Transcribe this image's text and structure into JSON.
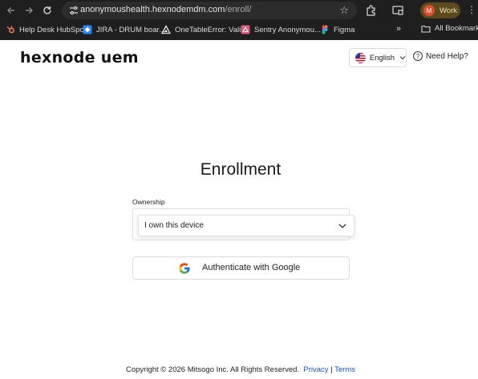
{
  "browser": {
    "url_host": "anonymoushealth.hexnodemdm.com",
    "url_path": "/enroll/",
    "profile_initial": "M",
    "profile_label": "Work",
    "bookmarks": [
      {
        "label": "Help Desk HubSpot",
        "icon": "hubspot-icon",
        "color": "#ff7a59"
      },
      {
        "label": "JIRA - DRUM boar...",
        "icon": "jira-icon",
        "color": "#2684ff"
      },
      {
        "label": "OneTableError: Vali...",
        "icon": "onetable-icon",
        "color": "#e3e3e3"
      },
      {
        "label": "Sentry Anonymou...",
        "icon": "sentry-icon",
        "color": "#e1567c"
      },
      {
        "label": "Figma",
        "icon": "figma-icon",
        "color": "#a259ff"
      }
    ],
    "bookmarks_more": "»",
    "all_bookmarks": "All Bookmarks"
  },
  "header": {
    "logo_text": "hexnode uem",
    "language": "English",
    "help": "Need Help?"
  },
  "main": {
    "title": "Enrollment",
    "ownership_label": "Ownership",
    "ownership_value": "I own this device",
    "google_button": "Authenticate with Google"
  },
  "footer": {
    "copyright": "Copyright © 2026 Mitsogo Inc. All Rights Reserved.",
    "privacy": "Privacy",
    "separator": "|",
    "terms": "Terms"
  },
  "colors": {
    "browser_bg": "#1f1f1f",
    "link": "#1a55c4",
    "profile_bg": "#5c4a1e"
  }
}
